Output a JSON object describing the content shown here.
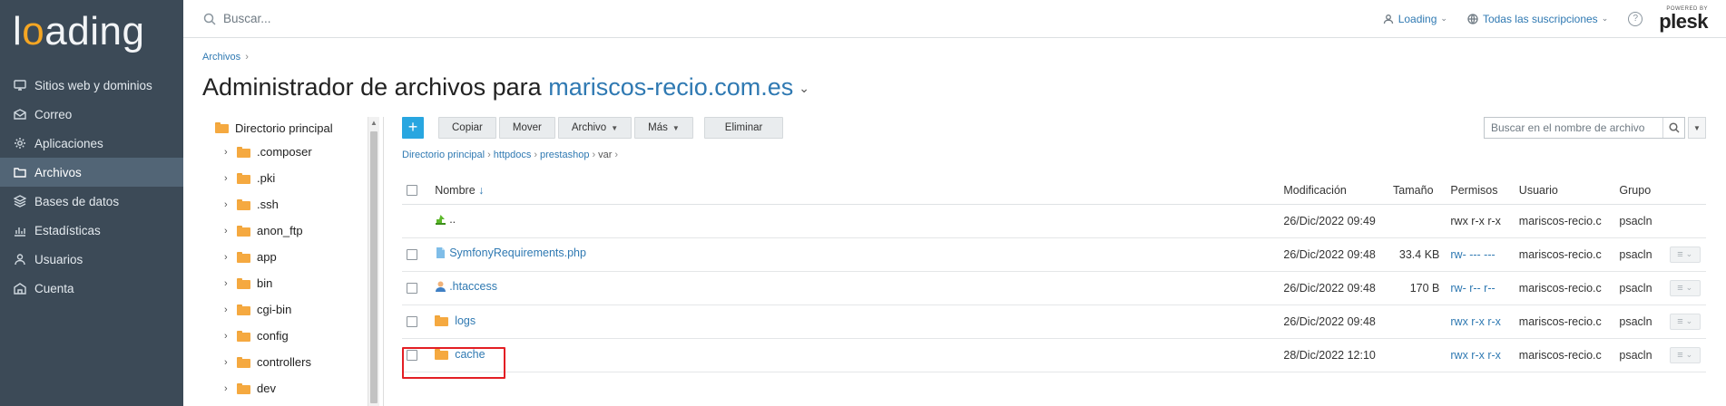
{
  "brand": {
    "logo_pre": "l",
    "logo_o": "o",
    "logo_post": "ading"
  },
  "sidebar": {
    "items": [
      {
        "label": "Sitios web y dominios",
        "icon": "monitor-icon"
      },
      {
        "label": "Correo",
        "icon": "mail-icon"
      },
      {
        "label": "Aplicaciones",
        "icon": "gear-icon"
      },
      {
        "label": "Archivos",
        "icon": "folder-icon",
        "active": true
      },
      {
        "label": "Bases de datos",
        "icon": "database-icon"
      },
      {
        "label": "Estadísticas",
        "icon": "chart-icon"
      },
      {
        "label": "Usuarios",
        "icon": "user-icon"
      },
      {
        "label": "Cuenta",
        "icon": "account-icon"
      }
    ]
  },
  "topbar": {
    "search_placeholder": "Buscar...",
    "user_label": "Loading",
    "subscriptions_label": "Todas las suscripciones",
    "help_label": "?",
    "powered_by": "POWERED BY",
    "plesk": "plesk"
  },
  "breadcrumb": {
    "item": "Archivos"
  },
  "title": {
    "prefix": "Administrador de archivos para",
    "domain": "mariscos-recio.com.es"
  },
  "tree": {
    "root": "Directorio principal",
    "items": [
      ".composer",
      ".pki",
      ".ssh",
      "anon_ftp",
      "app",
      "bin",
      "cgi-bin",
      "config",
      "controllers",
      "dev"
    ]
  },
  "toolbar": {
    "add": "+",
    "copy": "Copiar",
    "move": "Mover",
    "archive": "Archivo",
    "more": "Más",
    "delete": "Eliminar",
    "search_placeholder": "Buscar en el nombre de archivo"
  },
  "path": {
    "p1": "Directorio principal",
    "p2": "httpdocs",
    "p3": "prestashop",
    "current": "var"
  },
  "table": {
    "headers": {
      "name": "Nombre",
      "sort": "↓",
      "modified": "Modificación",
      "size": "Tamaño",
      "perms": "Permisos",
      "user": "Usuario",
      "group": "Grupo"
    },
    "rows": [
      {
        "name": "..",
        "modified": "26/Dic/2022 09:49",
        "size": "",
        "perms": "rwx r-x r-x",
        "user": "mariscos-recio.c",
        "group": "psacln"
      },
      {
        "name": "SymfonyRequirements.php",
        "modified": "26/Dic/2022 09:48",
        "size": "33.4 KB",
        "perms": "rw- --- ---",
        "user": "mariscos-recio.c",
        "group": "psacln"
      },
      {
        "name": ".htaccess",
        "modified": "26/Dic/2022 09:48",
        "size": "170 B",
        "perms": "rw- r-- r--",
        "user": "mariscos-recio.c",
        "group": "psacln"
      },
      {
        "name": "logs",
        "modified": "26/Dic/2022 09:48",
        "size": "",
        "perms": "rwx r-x r-x",
        "user": "mariscos-recio.c",
        "group": "psacln"
      },
      {
        "name": "cache",
        "modified": "28/Dic/2022 12:10",
        "size": "",
        "perms": "rwx r-x r-x",
        "user": "mariscos-recio.c",
        "group": "psacln"
      }
    ]
  },
  "colors": {
    "sidebar_bg": "#3c4a57",
    "accent": "#2f79b2",
    "add_button": "#28a6e0",
    "highlight": "#e31e24",
    "folder": "#f5a940"
  }
}
